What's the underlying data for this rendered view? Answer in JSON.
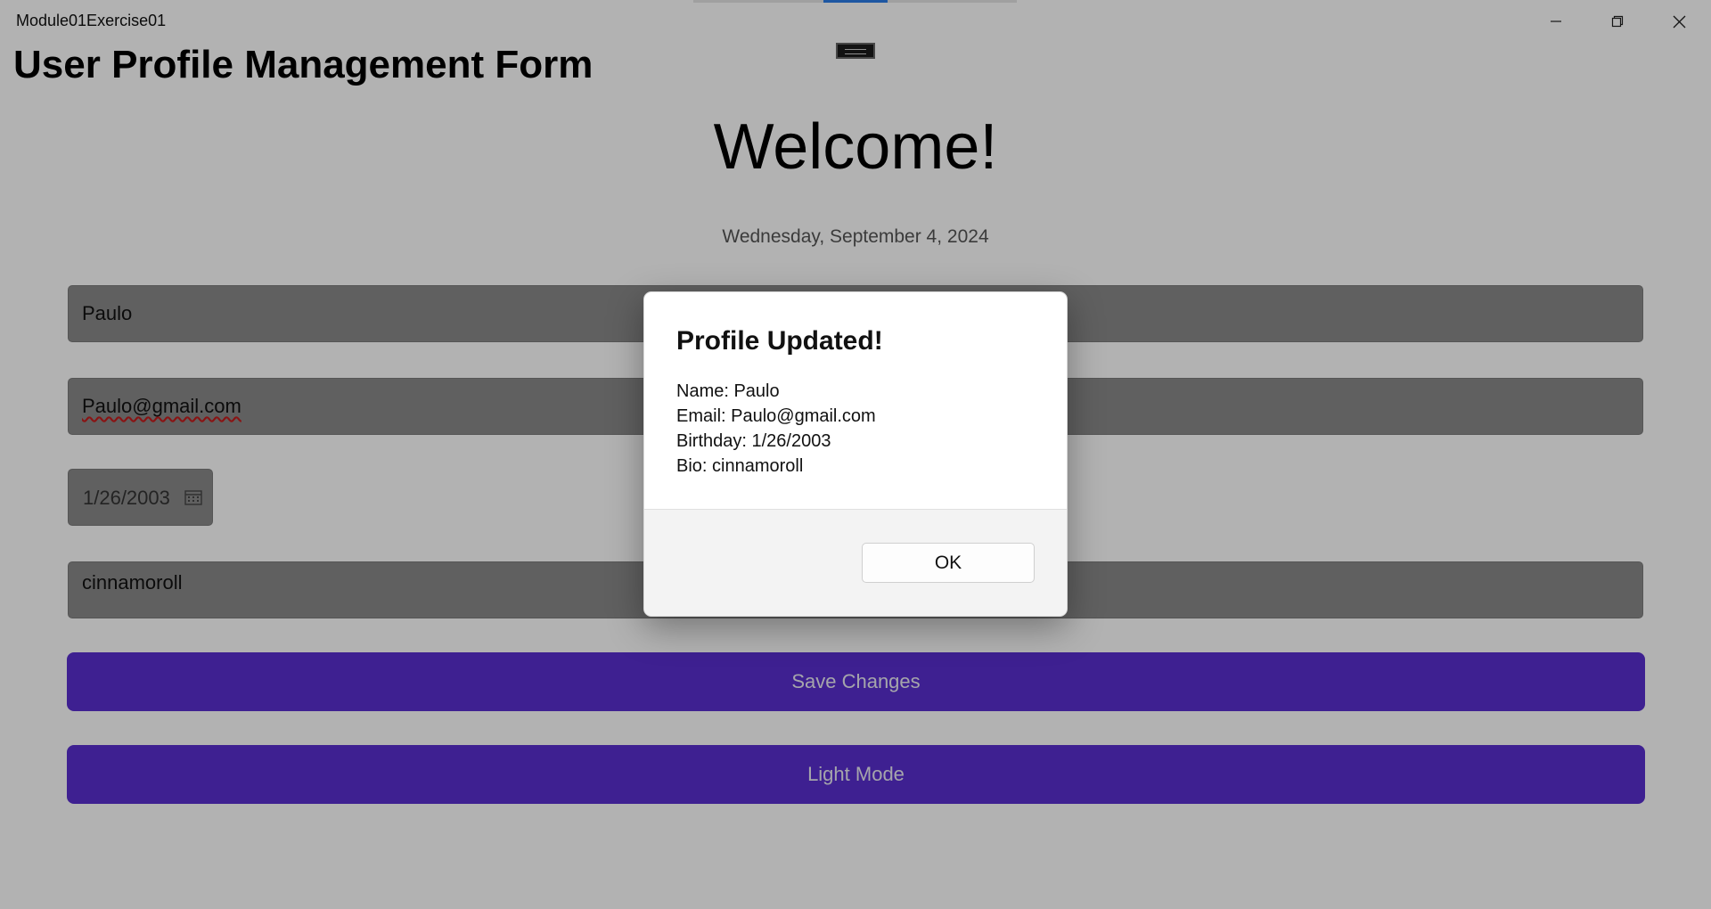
{
  "window": {
    "title": "Module01Exercise01",
    "controls": {
      "minimize_icon": "minimize-icon",
      "maximize_icon": "restore-icon",
      "close_icon": "close-icon"
    }
  },
  "page": {
    "heading": "User Profile Management Form",
    "welcome": "Welcome!",
    "date": "Wednesday, September 4, 2024"
  },
  "form": {
    "name_value": "Paulo",
    "email_value": "Paulo@gmail.com",
    "birthday_value": "1/26/2003",
    "bio_value": "cinnamoroll",
    "save_label": "Save Changes",
    "theme_label": "Light Mode"
  },
  "dialog": {
    "title": "Profile Updated!",
    "lines": {
      "name": "Name: Paulo",
      "email": "Email: Paulo@gmail.com",
      "birthday": "Birthday: 1/26/2003",
      "bio": "Bio: cinnamoroll"
    },
    "ok_label": "OK"
  },
  "colors": {
    "accent": "#5a2fd0",
    "overlay": "rgba(0,0,0,0.30)",
    "tab_active": "#2b7de9"
  }
}
